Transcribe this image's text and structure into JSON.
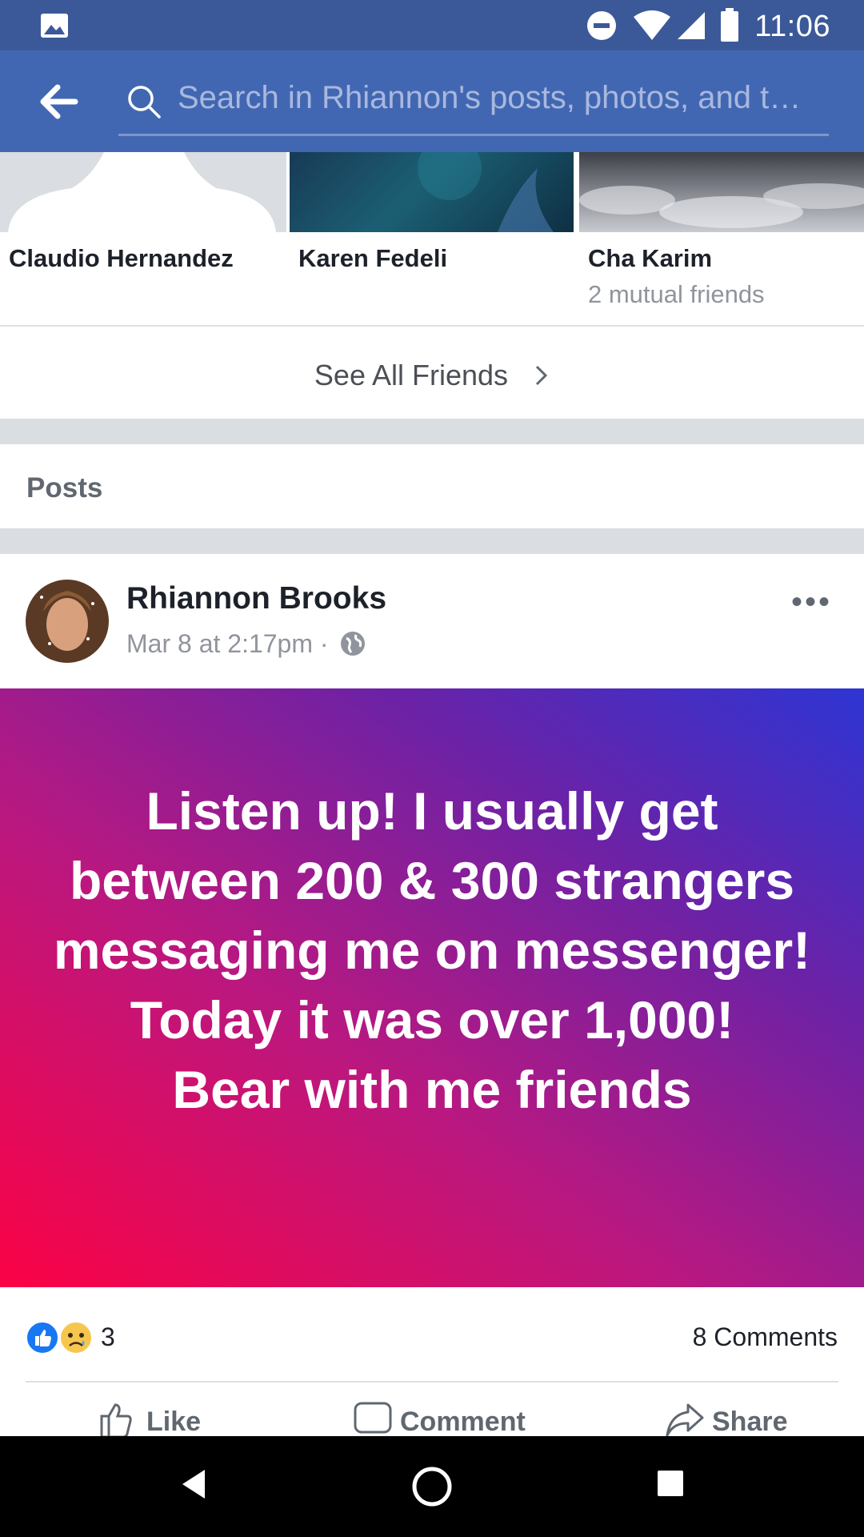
{
  "status_bar": {
    "time": "11:06"
  },
  "search": {
    "placeholder": "Search in Rhiannon's posts, photos, and t…"
  },
  "friends": [
    {
      "name": "Claudio Hernandez",
      "sub": ""
    },
    {
      "name": "Karen Fedeli",
      "sub": ""
    },
    {
      "name": "Cha Karim",
      "sub": "2 mutual friends"
    }
  ],
  "see_all_label": "See All Friends",
  "posts_heading": "Posts",
  "post": {
    "author": "Rhiannon Brooks",
    "time": "Mar 8 at 2:17pm",
    "text": "Listen up! I usually get between 200 & 300 strangers messaging me on messenger! Today it was over 1,000!\nBear with me friends",
    "reaction_count": "3",
    "comments_label": "8 Comments",
    "actions": {
      "like": "Like",
      "comment": "Comment",
      "share": "Share"
    }
  },
  "colors": {
    "header": "#4267b2",
    "status": "#3b5998"
  }
}
